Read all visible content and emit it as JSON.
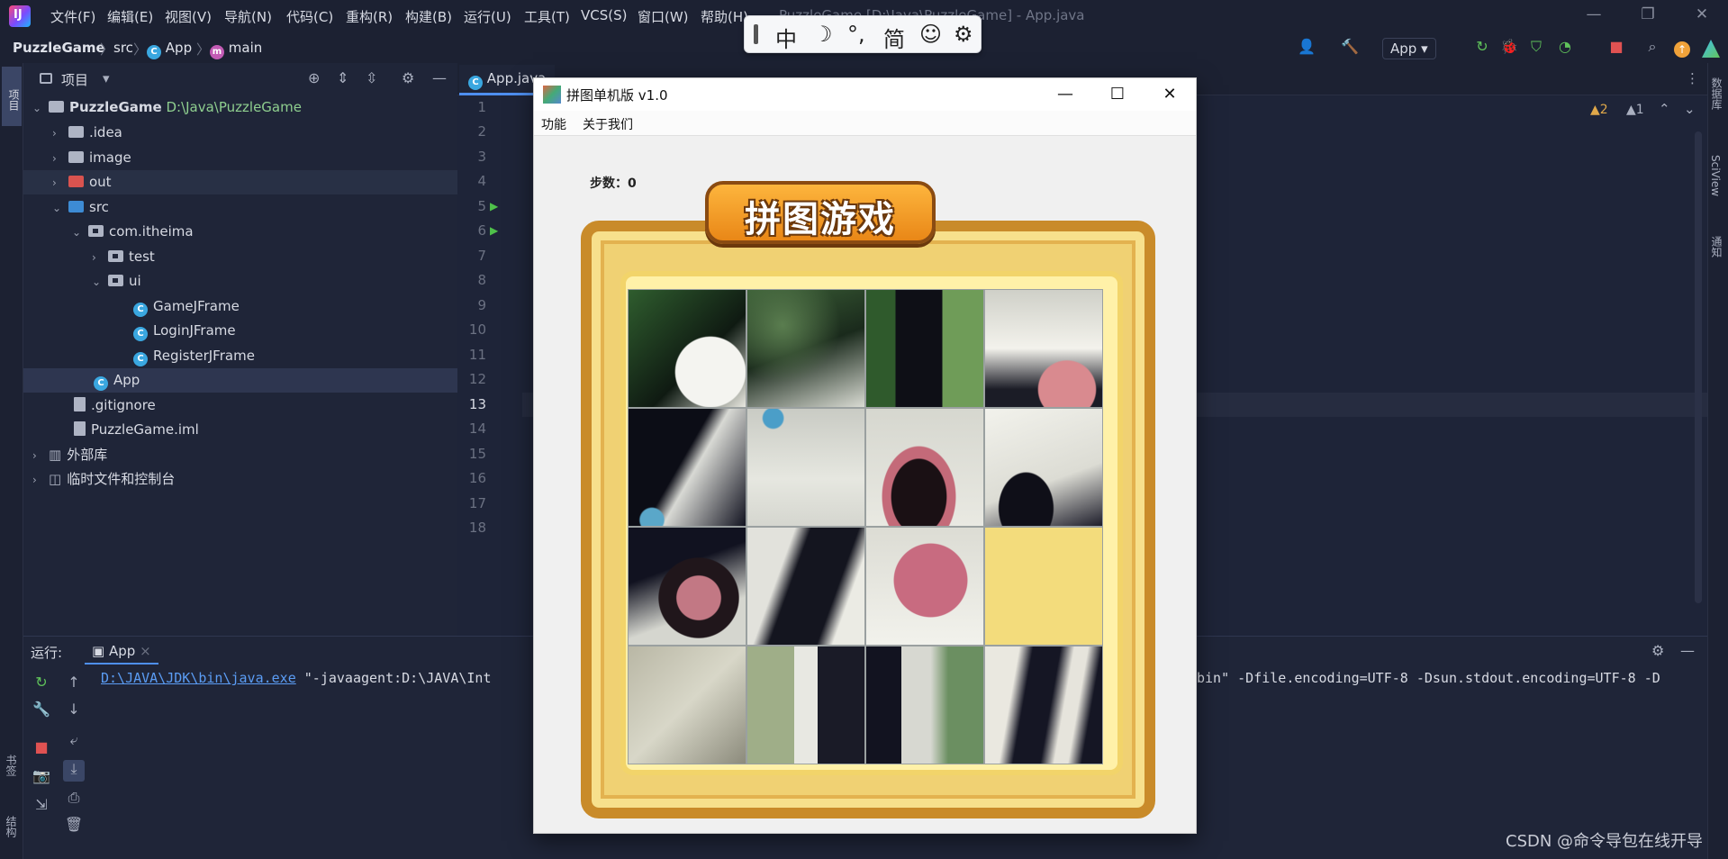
{
  "ide": {
    "menus": [
      "文件(F)",
      "编辑(E)",
      "视图(V)",
      "导航(N)",
      "代码(C)",
      "重构(R)",
      "构建(B)",
      "运行(U)",
      "工具(T)",
      "VCS(S)",
      "窗口(W)",
      "帮助(H)"
    ],
    "window_title": "PuzzleGame [D:\\Java\\PuzzleGame] - App.java",
    "breadcrumb": {
      "project": "PuzzleGame",
      "folder": "src",
      "file": "App",
      "method": "main"
    },
    "run_config": "App",
    "ime": {
      "chinese": "中",
      "moon": "☽",
      "punct": "°,",
      "simplified": "简",
      "emoji": "☺",
      "settings": "⚙"
    }
  },
  "project_panel": {
    "title": "项目",
    "tree": [
      {
        "label": "PuzzleGame",
        "path": "D:\\Java\\PuzzleGame"
      },
      {
        "label": ".idea"
      },
      {
        "label": "image"
      },
      {
        "label": "out"
      },
      {
        "label": "src"
      },
      {
        "label": "com.itheima"
      },
      {
        "label": "test"
      },
      {
        "label": "ui"
      },
      {
        "label": "GameJFrame"
      },
      {
        "label": "LoginJFrame"
      },
      {
        "label": "RegisterJFrame"
      },
      {
        "label": "App"
      },
      {
        "label": ".gitignore"
      },
      {
        "label": "PuzzleGame.iml"
      },
      {
        "label": "外部库"
      },
      {
        "label": "临时文件和控制台"
      }
    ]
  },
  "editor": {
    "tab": "App.java",
    "line_numbers": [
      "1",
      "2",
      "3",
      "4",
      "5",
      "6",
      "7",
      "8",
      "9",
      "10",
      "11",
      "12",
      "13",
      "14",
      "15",
      "16",
      "17",
      "18"
    ],
    "warnings": "▲2",
    "weak_warnings": "▲1"
  },
  "left_strip": {
    "project_tab": "项目",
    "bookmarks": "书签",
    "structure": "结构"
  },
  "right_strip": {
    "database": "数据库",
    "sciview": "SciView",
    "notifications": "通知"
  },
  "run_panel": {
    "label": "运行:",
    "tab": "App",
    "console_link": "D:\\JAVA\\JDK\\bin\\java.exe",
    "console_rest": " \"-javaagent:D:\\JAVA\\Int",
    "console_tail": "bin\" -Dfile.encoding=UTF-8 -Dsun.stdout.encoding=UTF-8 -D"
  },
  "game": {
    "title": "拼图单机版 v1.0",
    "menu": [
      "功能",
      "关于我们"
    ],
    "steps_label": "步数：",
    "steps_value": "0",
    "banner": "拼图游戏",
    "tiles": [
      1,
      2,
      3,
      4,
      5,
      6,
      7,
      8,
      9,
      10,
      11,
      0,
      12,
      13,
      14,
      15
    ]
  },
  "watermark": "CSDN @命令导包在线开导"
}
